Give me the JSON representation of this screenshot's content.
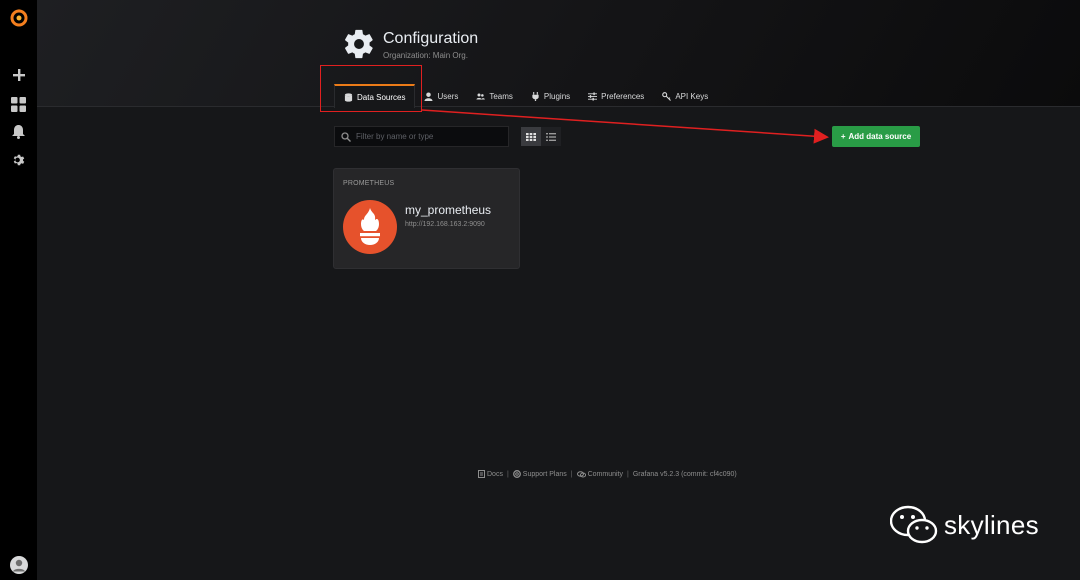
{
  "sidebar": {
    "items": [
      {
        "icon": "grafana-logo-icon"
      },
      {
        "icon": "plus-icon"
      },
      {
        "icon": "dashboards-icon"
      },
      {
        "icon": "bell-icon"
      },
      {
        "icon": "gear-icon"
      },
      {
        "icon": "user-avatar-icon"
      }
    ]
  },
  "header": {
    "title": "Configuration",
    "subtitle": "Organization: Main Org."
  },
  "tabs": [
    {
      "label": "Data Sources",
      "icon": "database-icon",
      "active": true
    },
    {
      "label": "Users",
      "icon": "user-icon"
    },
    {
      "label": "Teams",
      "icon": "teams-icon"
    },
    {
      "label": "Plugins",
      "icon": "plug-icon"
    },
    {
      "label": "Preferences",
      "icon": "sliders-icon"
    },
    {
      "label": "API Keys",
      "icon": "key-icon"
    }
  ],
  "toolbar": {
    "search_placeholder": "Filter by name or type",
    "add_label": "Add data source"
  },
  "datasource": {
    "type": "PROMETHEUS",
    "name": "my_prometheus",
    "url": "http://192.168.163.2:9090"
  },
  "footer": {
    "docs": "Docs",
    "support": "Support Plans",
    "community": "Community",
    "version": "Grafana v5.2.3 (commit: cf4c090)"
  },
  "watermark": {
    "text": "skylines"
  },
  "colors": {
    "accent": "#eb7b18",
    "add_button": "#299c46",
    "annotation": "#e02020",
    "prometheus": "#e6522c"
  }
}
